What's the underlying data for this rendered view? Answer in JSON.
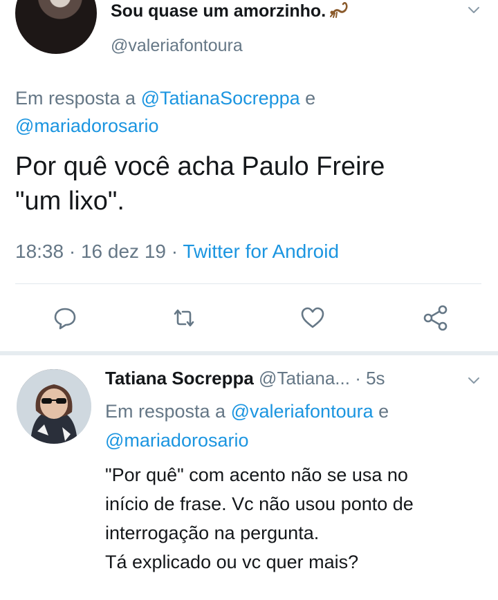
{
  "main_tweet": {
    "display_name": "Sou quase um amorzinho.",
    "handle": "@valeriafontoura",
    "reply_prefix": "Em resposta a",
    "reply_mention_1": "@TatianaSocreppa",
    "reply_and": "e",
    "reply_mention_2": "@mariadorosario",
    "text_line_1": "Por quê você acha Paulo Freire",
    "text_line_2": "\"um lixo\".",
    "time": "18:38",
    "date": "16 dez 19",
    "source": "Twitter for Android",
    "dot": "·"
  },
  "second_tweet": {
    "display_name": "Tatiana Socreppa",
    "handle": "@Tatiana...",
    "time": "5s",
    "dot": "·",
    "reply_prefix": "Em resposta a",
    "reply_mention_1": "@valeriafontoura",
    "reply_and": "e",
    "reply_mention_2": "@mariadorosario",
    "text_line_1": "\"Por quê\" com acento não se usa no",
    "text_line_2": "início de frase. Vc não usou ponto de",
    "text_line_3": "interrogação na pergunta.",
    "text_line_4": "Tá explicado ou vc quer mais?"
  },
  "icons": {
    "reply": "reply-icon",
    "retweet": "retweet-icon",
    "like": "heart-icon",
    "share": "share-icon",
    "menu": "chevron-down-icon",
    "emoji": "scorpion-icon"
  },
  "colors": {
    "text": "#14171a",
    "secondary": "#657786",
    "link": "#1b95e0",
    "divider": "#e1e8ed"
  }
}
